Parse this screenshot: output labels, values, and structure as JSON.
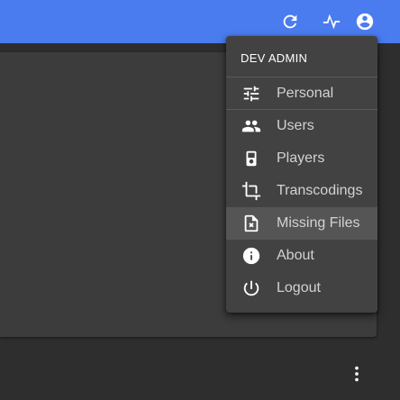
{
  "appbar": {
    "refresh_icon": "refresh-icon",
    "activity_icon": "activity-pulse-icon",
    "account_icon": "account-circle-icon",
    "color": "#4a7cf0"
  },
  "user_menu": {
    "header": "DEV ADMIN",
    "items": [
      {
        "label": "Personal",
        "icon": "tune-sliders-icon"
      },
      {
        "label": "Users",
        "icon": "people-icon"
      },
      {
        "label": "Players",
        "icon": "player-device-icon"
      },
      {
        "label": "Transcodings",
        "icon": "transform-crop-icon"
      },
      {
        "label": "Missing Files",
        "icon": "missing-file-icon",
        "highlighted": true
      },
      {
        "label": "About",
        "icon": "info-icon"
      },
      {
        "label": "Logout",
        "icon": "power-icon"
      }
    ]
  },
  "footer": {
    "more_icon": "more-vertical-icon"
  }
}
